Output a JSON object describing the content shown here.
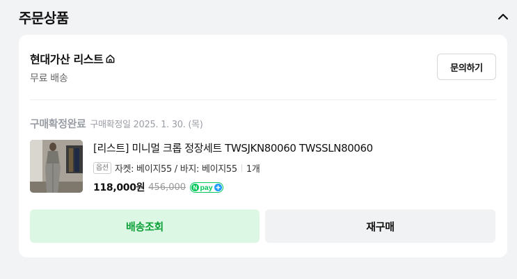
{
  "section": {
    "title": "주문상품",
    "collapse_icon": "chevron-up-icon"
  },
  "order": {
    "store": {
      "name": "현대가산 리스트",
      "icon": "home-icon",
      "shipping": "무료 배송",
      "inquiry_label": "문의하기"
    },
    "status": "구매확정완료",
    "confirm_date": "구매확정일 2025. 1. 30. (목)",
    "item": {
      "name": "[리스트] 미니멀 크롭 정장세트 TWSJKN80060 TWSSLN80060",
      "option_badge": "옵션",
      "option_text": "자켓: 베이지55 / 바지: 베이지55",
      "quantity": "1개",
      "price": "118,000원",
      "original_price": "456,000",
      "pay_badge": "pay"
    },
    "buttons": {
      "track_label": "배송조회",
      "reorder_label": "재구매"
    }
  },
  "colors": {
    "track_bg": "#ddf7e5",
    "track_text": "#0ea13a",
    "npay_green": "#03c75a",
    "npay_plus": "#1e9bff",
    "status_gray": "#9a9ea5"
  }
}
